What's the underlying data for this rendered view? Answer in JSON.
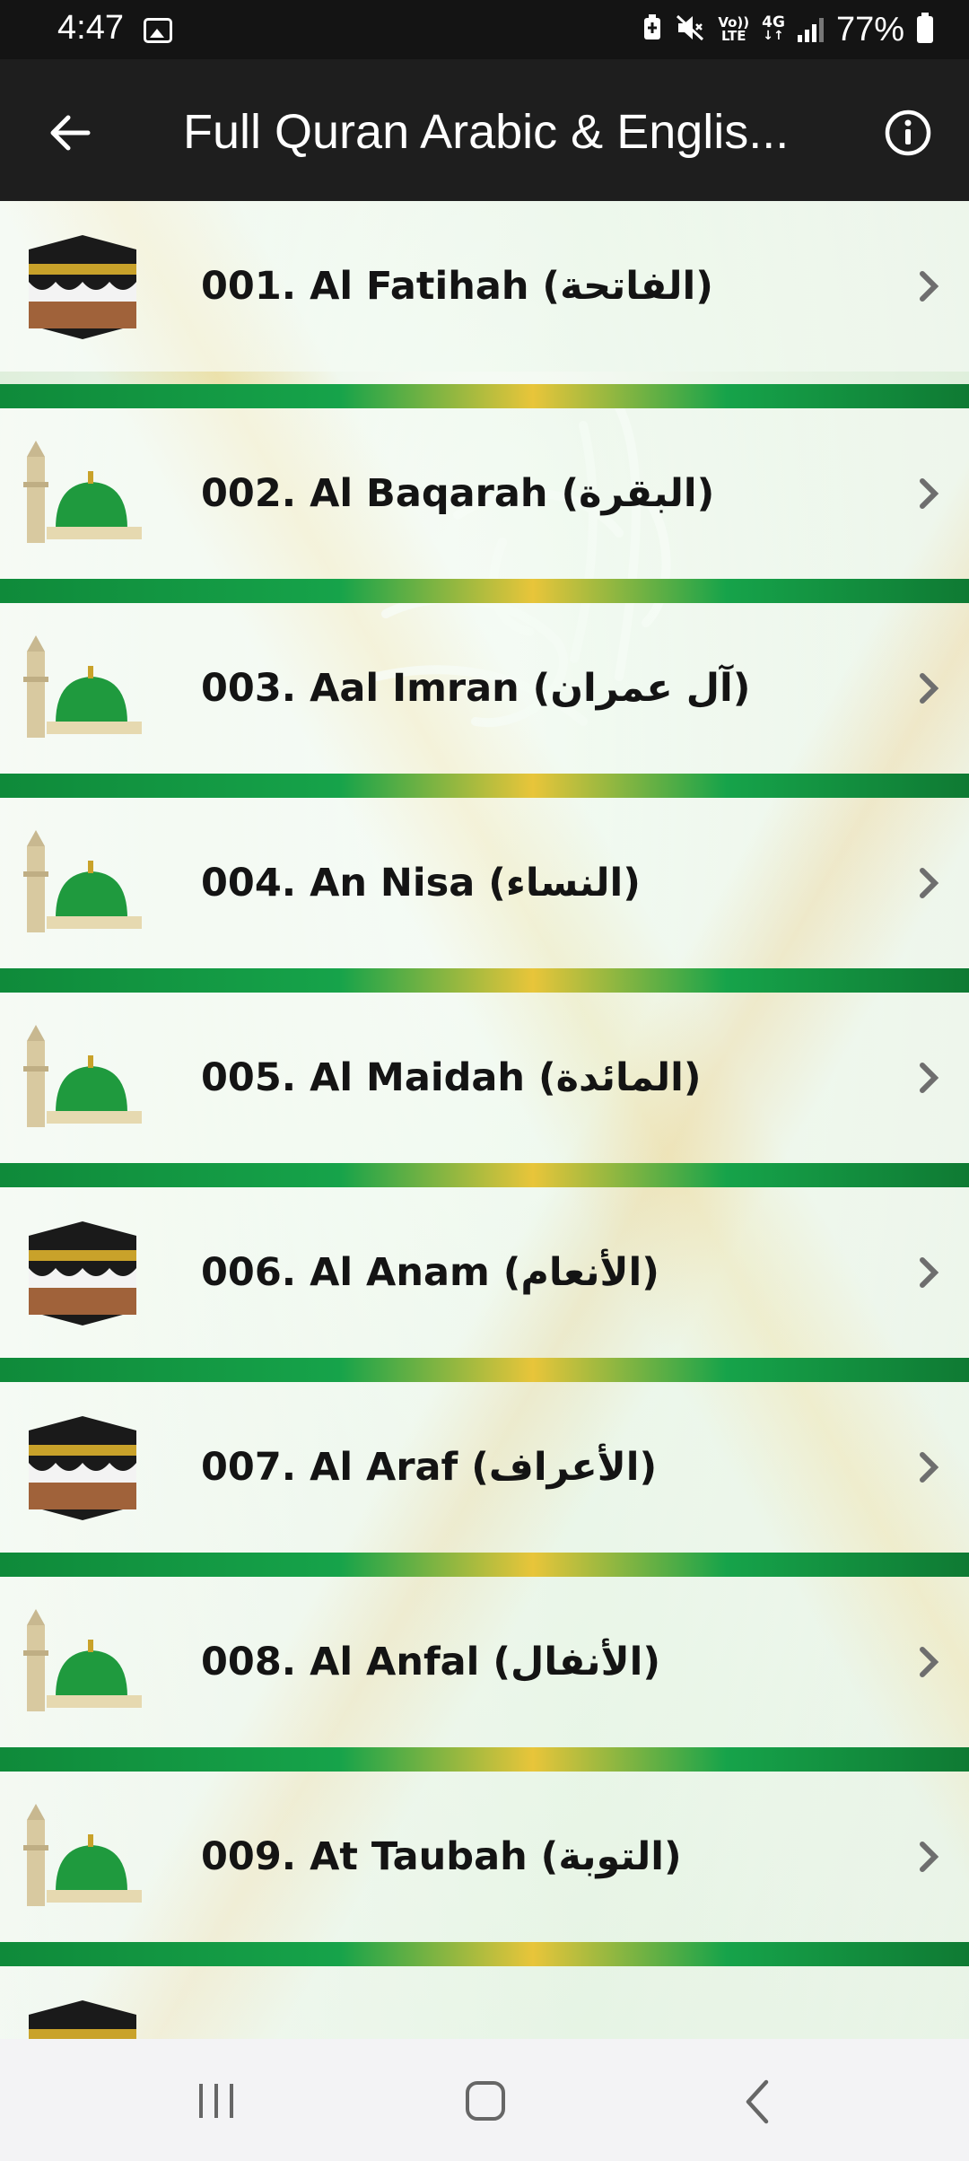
{
  "status_bar": {
    "time": "4:47",
    "network_line1": "Vo))",
    "network_line2": "LTE",
    "network_4g": "4G",
    "battery_percent": "77%",
    "icons": [
      "image-icon",
      "battery-saver-icon",
      "mute-icon",
      "volte-icon",
      "data-4g-icon",
      "signal-icon",
      "battery-icon"
    ]
  },
  "app_bar": {
    "title": "Full Quran Arabic & Englis...",
    "icons": [
      "back-arrow-icon",
      "info-icon"
    ]
  },
  "surahs": [
    {
      "label": "001. Al Fatihah (الفاتحة)",
      "thumbnail": "kaaba-icon"
    },
    {
      "label": "002. Al Baqarah (البقرة)",
      "thumbnail": "green-dome-icon"
    },
    {
      "label": "003. Aal Imran (آل عمران)",
      "thumbnail": "green-dome-icon"
    },
    {
      "label": "004. An Nisa (النساء)",
      "thumbnail": "green-dome-icon"
    },
    {
      "label": "005. Al Maidah (المائدة)",
      "thumbnail": "green-dome-icon"
    },
    {
      "label": "006. Al Anam (الأنعام)",
      "thumbnail": "kaaba-icon"
    },
    {
      "label": "007. Al Araf (الأعراف)",
      "thumbnail": "kaaba-icon"
    },
    {
      "label": "008. Al Anfal (الأنفال)",
      "thumbnail": "green-dome-icon"
    },
    {
      "label": "009. At Taubah (التوبة)",
      "thumbnail": "green-dome-icon"
    }
  ],
  "colors": {
    "status_bar": "#141414",
    "app_bar": "#1e1e1e",
    "divider_green": "#16a34a",
    "divider_gold": "#e8c53a",
    "dome_green": "#1f9a3e",
    "chevron": "#6e6e6e",
    "nav_bar": "#f3f3f5"
  },
  "nav_bar": {
    "icons": [
      "recents-icon",
      "home-icon",
      "back-icon"
    ]
  }
}
